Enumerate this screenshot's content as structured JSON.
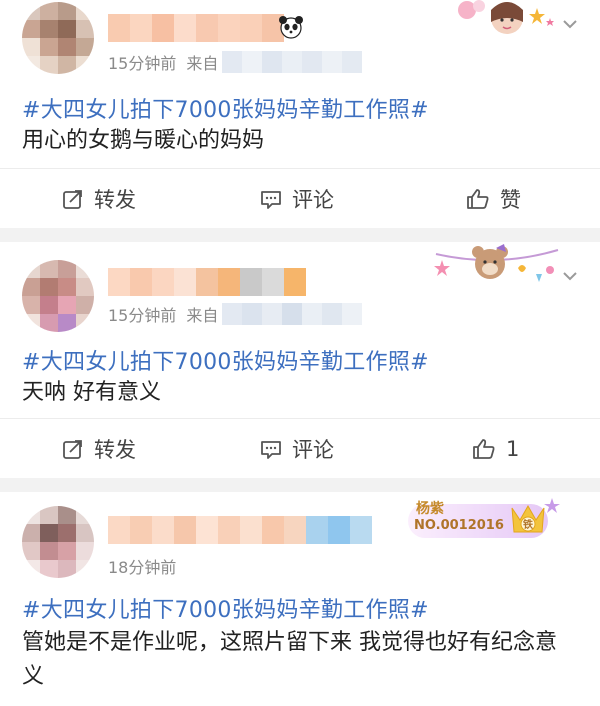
{
  "topic": "#大四女儿拍下7000张妈妈辛勤工作照#",
  "posts": [
    {
      "time": "15分钟前",
      "source_label": "来自",
      "text": "用心的女鹅与暖心的妈妈",
      "actions": {
        "repost": "转发",
        "comment": "评论",
        "like": "赞"
      }
    },
    {
      "time": "15分钟前",
      "source_label": "来自",
      "text": "天呐 好有意义",
      "actions": {
        "repost": "转发",
        "comment": "评论",
        "like": "1"
      }
    },
    {
      "time": "18分钟前",
      "text": "管她是不是作业呢，这照片留下来 我觉得也好有纪念意义",
      "badge": {
        "name": "杨紫",
        "number": "NO.0012016",
        "tier": "铁"
      }
    }
  ],
  "colors": {
    "topic": "#3d6fbf",
    "meta": "#8a8a8a",
    "separator": "#f2f2f2"
  }
}
